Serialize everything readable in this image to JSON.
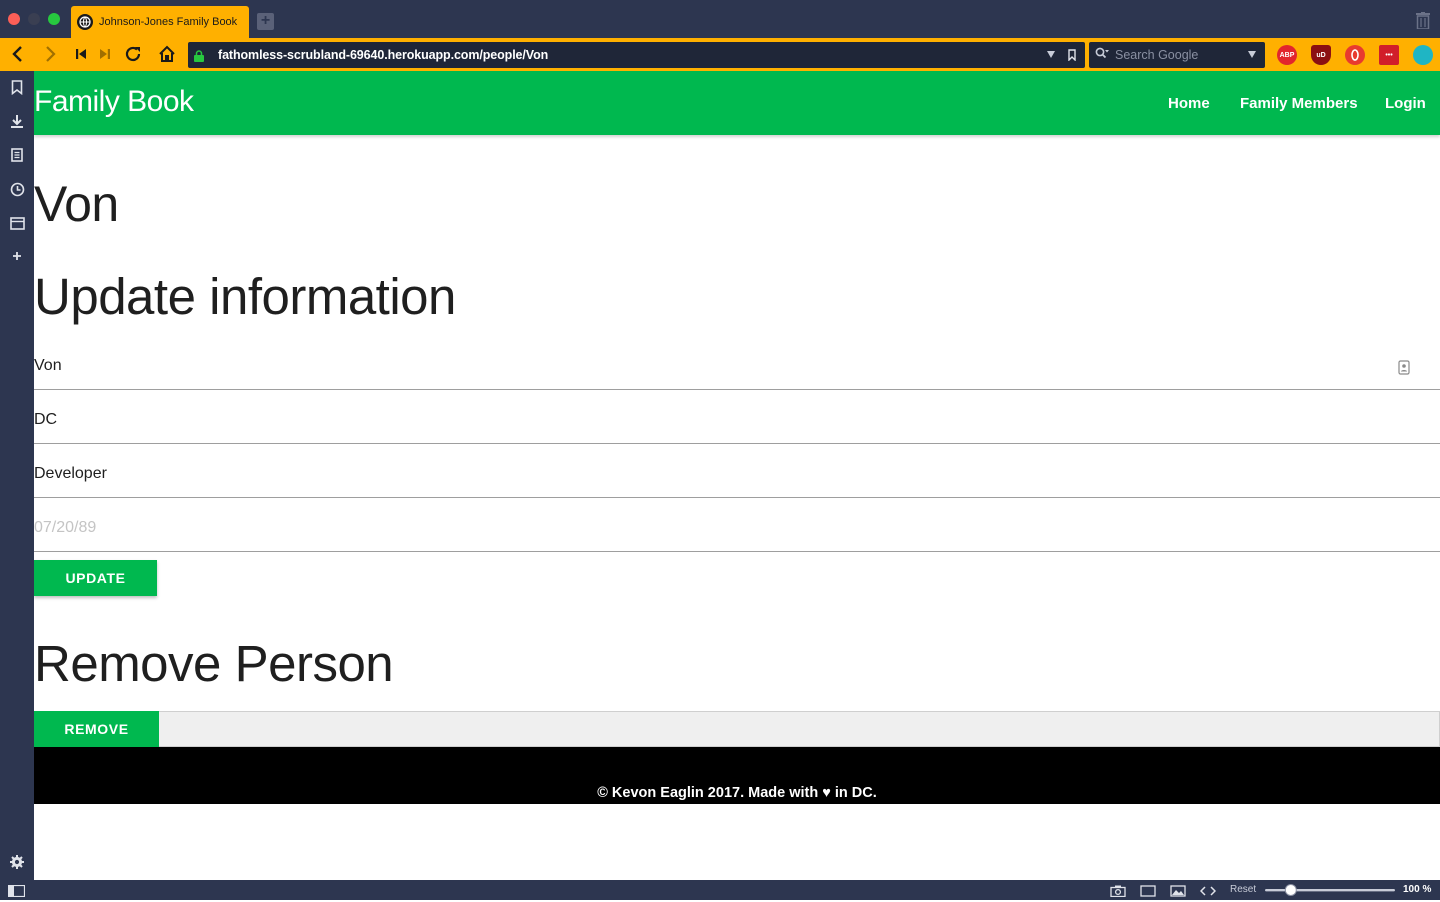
{
  "browser": {
    "tab_title": "Johnson-Jones Family Book",
    "url": "fathomless-scrubland-69640.herokuapp.com/people/Von",
    "search_placeholder": "Search Google",
    "extensions": [
      "ABP",
      "uD",
      "",
      "•••",
      ""
    ],
    "zoom_label": "Reset",
    "zoom_percent": "100 %",
    "zoom_level": 0.1
  },
  "site": {
    "brand": "Family Book",
    "nav": {
      "home": "Home",
      "members": "Family Members",
      "login": "Login"
    }
  },
  "person": {
    "name": "Von"
  },
  "update_section": {
    "heading": "Update information",
    "fields": {
      "name": "Von",
      "location": "DC",
      "occupation": "Developer",
      "birthday_placeholder": "07/20/89"
    },
    "button_label": "UPDATE"
  },
  "remove_section": {
    "heading": "Remove Person",
    "button_label": "REMOVE"
  },
  "footer": {
    "text": "© Kevon Eaglin 2017. Made with ♥ in DC."
  },
  "colors": {
    "brand_green": "#00b84f",
    "browser_accent": "#ffb000",
    "browser_dark": "#2d3650"
  }
}
